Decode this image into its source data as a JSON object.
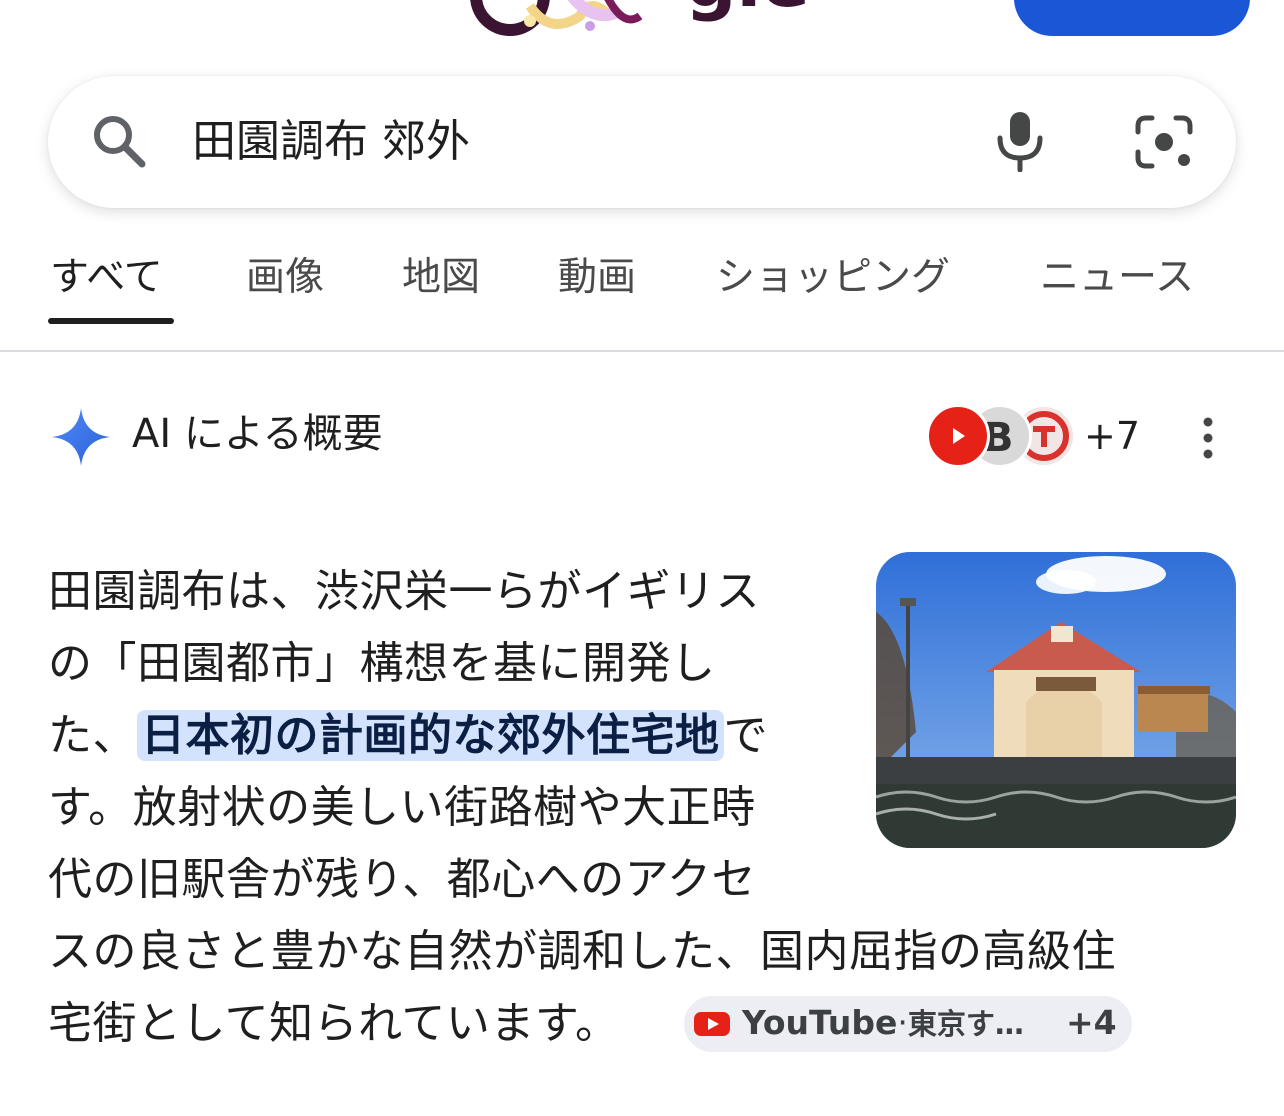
{
  "search": {
    "query": "田園調布 郊外"
  },
  "tabs": [
    {
      "label": "すべて",
      "active": true
    },
    {
      "label": "画像",
      "active": false
    },
    {
      "label": "地図",
      "active": false
    },
    {
      "label": "動画",
      "active": false
    },
    {
      "label": "ショッピング",
      "active": false
    },
    {
      "label": "ニュース",
      "active": false
    }
  ],
  "ai_overview": {
    "title": "AI による概要",
    "sources_more": "+7",
    "answer_lines": [
      "田園調布は、渋沢栄一らがイギリス",
      "の「田園都市」構想を基に開発し",
      "た、",
      "日本初の計画的な郊外住宅地",
      "で",
      "す。放射状の美しい街路樹や大正時",
      "代の旧駅舎が残り、都心へのアクセ",
      "スの良さと豊かな自然が調和した、国内屈指の高級住",
      "宅街として知られています。"
    ],
    "citation": {
      "source": "YouTube",
      "separator": "·",
      "site": "東京す…",
      "more": "+4"
    }
  },
  "colors": {
    "accent_blue": "#1a57d6",
    "highlight": "#d3e3fd",
    "youtube_red": "#e62117"
  },
  "icons": [
    "search-icon",
    "mic-icon",
    "camera-lens-icon",
    "sparkle-icon",
    "more-vert-icon",
    "youtube-icon"
  ]
}
